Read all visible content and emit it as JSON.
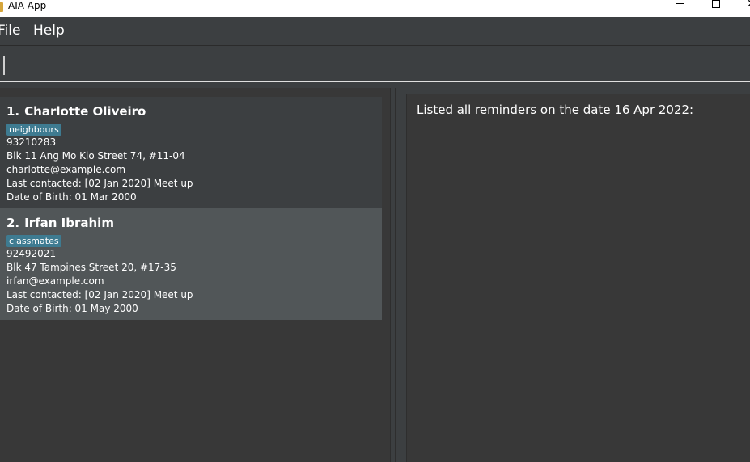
{
  "window": {
    "title": "AIA App"
  },
  "menu": {
    "items": [
      "File",
      "Help"
    ]
  },
  "command": {
    "value": "",
    "placeholder": ""
  },
  "persons": [
    {
      "index": "1.",
      "name": "Charlotte Oliveiro",
      "tag": "neighbours",
      "phone": "93210283",
      "address": "Blk 11 Ang Mo Kio Street 74, #11-04",
      "email": "charlotte@example.com",
      "last_contacted": "Last contacted: [02 Jan 2020] Meet up",
      "dob": "Date of Birth: 01 Mar 2000"
    },
    {
      "index": "2.",
      "name": "Irfan Ibrahim",
      "tag": "classmates",
      "phone": "92492021",
      "address": "Blk 47 Tampines Street 20, #17-35",
      "email": "irfan@example.com",
      "last_contacted": "Last contacted: [02 Jan 2020] Meet up",
      "dob": "Date of Birth: 01 May 2000"
    }
  ],
  "result": {
    "message": "Listed all reminders on the date 16 Apr 2022:"
  },
  "colors": {
    "background": "#3c3f41",
    "list_background": "#383838",
    "selected_card": "#515658",
    "tag": "#3e7b91",
    "text": "#ffffff"
  }
}
